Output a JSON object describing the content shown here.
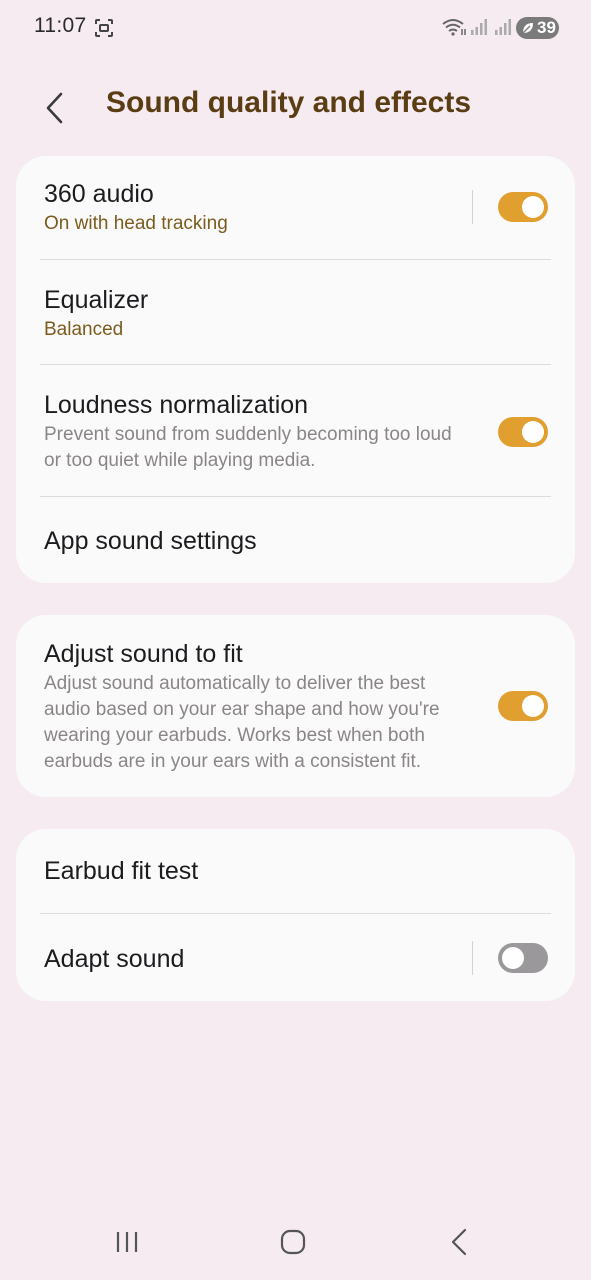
{
  "status_bar": {
    "time": "11:07",
    "battery_level": "39"
  },
  "header": {
    "title": "Sound quality and effects"
  },
  "card1": {
    "audio360": {
      "title": "360 audio",
      "subtitle": "On with head tracking",
      "toggle_on": true
    },
    "equalizer": {
      "title": "Equalizer",
      "subtitle": "Balanced"
    },
    "loudness": {
      "title": "Loudness normalization",
      "desc_line1": "Prevent sound from suddenly becoming too loud",
      "desc_line2": "or too quiet while playing media.",
      "toggle_on": true
    },
    "app_sound": {
      "title": "App sound settings"
    }
  },
  "card2": {
    "adjust_fit": {
      "title": "Adjust sound to fit",
      "desc_line1": "Adjust sound automatically to deliver the best",
      "desc_line2": "audio based on your ear shape and how you're",
      "desc_line3": "wearing your earbuds. Works best when both",
      "desc_line4": "earbuds are in your ears with a consistent fit.",
      "toggle_on": true
    }
  },
  "card3": {
    "fit_test": {
      "title": "Earbud fit test"
    },
    "adapt_sound": {
      "title": "Adapt sound",
      "toggle_on": false
    }
  },
  "colors": {
    "background": "#f5ebf1",
    "card": "#fbfafb",
    "title_brown": "#5b3d14",
    "accent_subtitle": "#7a5c1d",
    "toggle_on": "#e19f30",
    "toggle_off": "#9b989c"
  },
  "icons": {
    "status": [
      "screenshot-icon",
      "wifi-icon",
      "signal-icon",
      "signal-icon",
      "battery-icon"
    ],
    "header": "back-arrow-icon",
    "nav": [
      "recent-apps-icon",
      "home-icon",
      "back-icon"
    ]
  }
}
